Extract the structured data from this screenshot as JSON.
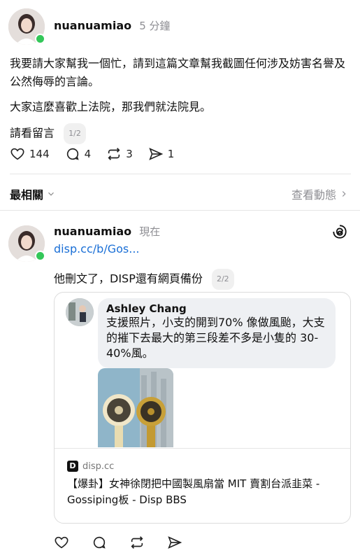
{
  "post1": {
    "username": "nuanuamiao",
    "time": "5 分鐘",
    "paragraph1": "我要請大家幫我一個忙，請到這篇文章幫我截圖任何涉及妨害名譽及公然侮辱的言論。",
    "paragraph2": "大家這麼喜歡上法院，那我們就法院見。",
    "paragraph3": "請看留言",
    "page_indicator": "1/2",
    "likes": "144",
    "comments": "4",
    "reposts": "3",
    "shares": "1"
  },
  "sort_bar": {
    "sort_label": "最相關",
    "activity_label": "查看動態"
  },
  "post2": {
    "username": "nuanuamiao",
    "time": "現在",
    "link": "disp.cc/b/Gos...",
    "text": "他刪文了，DISP還有網頁備份",
    "page_indicator": "2/2",
    "card": {
      "commenter": "Ashley Chang",
      "comment": "支援照片，小支的開到70% 像做風颱，大支的摧下去最大的第三段差不多是小隻的 30-40%風。",
      "source": "disp.cc",
      "title": "【爆卦】女神徐閉把中國製風扇當 MIT 賣割台派韭菜 - Gossiping板 - Disp BBS"
    }
  },
  "icons": {
    "like": "heart-icon",
    "comment": "comment-icon",
    "repost": "repost-icon",
    "share": "send-icon",
    "threads": "threads-logo-icon"
  },
  "colors": {
    "link": "#1a6fd6",
    "online": "#34c759",
    "muted": "#8e8e93"
  }
}
